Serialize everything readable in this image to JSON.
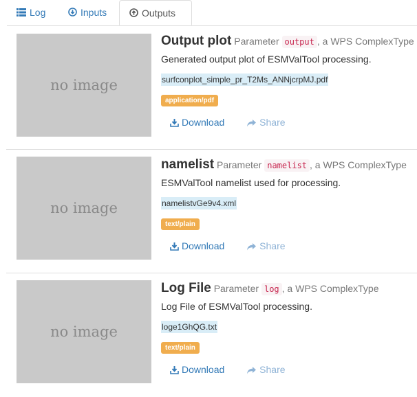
{
  "tabs": [
    {
      "label": "Log",
      "icon": "list-icon"
    },
    {
      "label": "Inputs",
      "icon": "circle-down-icon"
    },
    {
      "label": "Outputs",
      "icon": "circle-up-icon",
      "active": true
    }
  ],
  "outputs": [
    {
      "thumbnail": "no image",
      "title": "Output plot",
      "param_prefix": "Parameter",
      "param_name": "output",
      "param_suffix": ", a WPS ComplexType",
      "description": "Generated output plot of ESMValTool processing.",
      "filename": "surfconplot_simple_pr_T2Ms_ANNjcrpMJ.pdf",
      "mimetype": "application/pdf",
      "download_label": "Download",
      "share_label": "Share"
    },
    {
      "thumbnail": "no image",
      "title": "namelist",
      "param_prefix": "Parameter",
      "param_name": "namelist",
      "param_suffix": ", a WPS ComplexType",
      "description": "ESMValTool namelist used for processing.",
      "filename": "namelistvGe9v4.xml",
      "mimetype": "text/plain",
      "download_label": "Download",
      "share_label": "Share"
    },
    {
      "thumbnail": "no image",
      "title": "Log File",
      "param_prefix": "Parameter",
      "param_name": "log",
      "param_suffix": ", a WPS ComplexType",
      "description": "Log File of ESMValTool processing.",
      "filename": "loge1GhQG.txt",
      "mimetype": "text/plain",
      "download_label": "Download",
      "share_label": "Share"
    }
  ],
  "colors": {
    "link": "#337ab7",
    "badge": "#f0ad4e",
    "filename_bg": "#d9edf7",
    "code": "#c7254e"
  }
}
